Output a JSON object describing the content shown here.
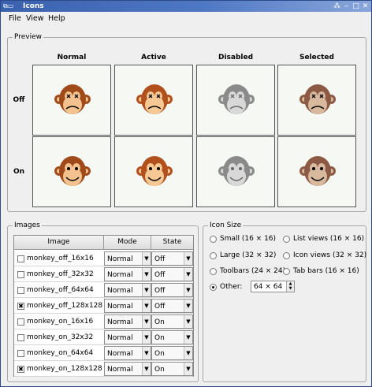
{
  "window": {
    "title": "Icons",
    "app_icon": "app-icon"
  },
  "menubar": {
    "items": [
      "File",
      "View",
      "Help"
    ]
  },
  "preview": {
    "title": "Preview",
    "columns": [
      "Normal",
      "Active",
      "Disabled",
      "Selected"
    ],
    "rows": [
      "Off",
      "On"
    ]
  },
  "images": {
    "title": "Images",
    "headers": [
      "Image",
      "Mode",
      "State"
    ],
    "rows": [
      {
        "checked": false,
        "name": "monkey_off_16x16",
        "mode": "Normal",
        "state": "Off"
      },
      {
        "checked": false,
        "name": "monkey_off_32x32",
        "mode": "Normal",
        "state": "Off"
      },
      {
        "checked": false,
        "name": "monkey_off_64x64",
        "mode": "Normal",
        "state": "Off"
      },
      {
        "checked": true,
        "name": "monkey_off_128x128",
        "mode": "Normal",
        "state": "Off"
      },
      {
        "checked": false,
        "name": "monkey_on_16x16",
        "mode": "Normal",
        "state": "On"
      },
      {
        "checked": false,
        "name": "monkey_on_32x32",
        "mode": "Normal",
        "state": "On"
      },
      {
        "checked": false,
        "name": "monkey_on_64x64",
        "mode": "Normal",
        "state": "On"
      },
      {
        "checked": true,
        "name": "monkey_on_128x128",
        "mode": "Normal",
        "state": "On"
      }
    ]
  },
  "icon_size": {
    "title": "Icon Size",
    "options_left": [
      "Small (16 × 16)",
      "Large (32 × 32)",
      "Toolbars (24 × 24)",
      "Other:"
    ],
    "options_right": [
      "List views (16 × 16)",
      "Icon views (32 × 32)",
      "Tab bars (16 × 16)"
    ],
    "selected": "Other:",
    "other_value": "64 × 64"
  }
}
